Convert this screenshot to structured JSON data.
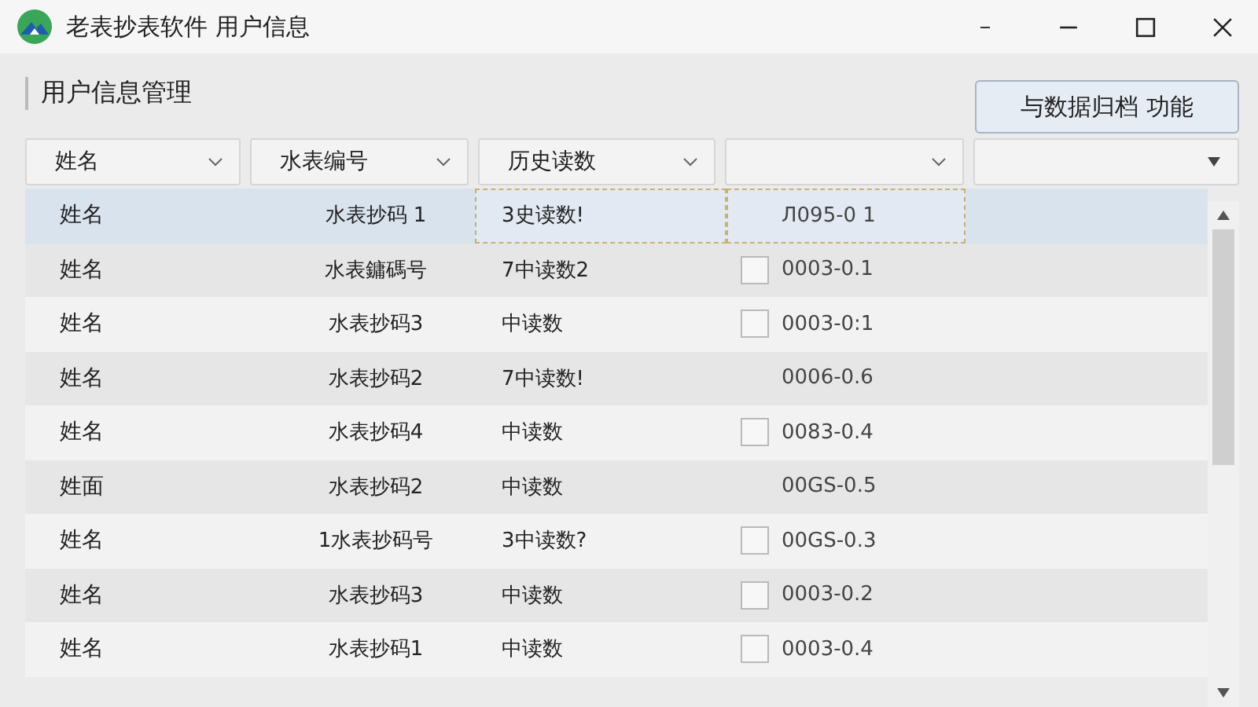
{
  "window": {
    "title": "老表抄表软件 用户信息"
  },
  "panel": {
    "heading": "用户信息管理",
    "action_button": "与数据归档 功能"
  },
  "table": {
    "columns": [
      {
        "label": "姓名"
      },
      {
        "label": "水表编号"
      },
      {
        "label": "历史读数"
      },
      {},
      {}
    ],
    "rows": [
      {
        "selected": true,
        "kind": "plain",
        "name": "姓名",
        "meter": "水表抄码 1",
        "history": "3史读数!",
        "code": "Л095-0 1"
      },
      {
        "selected": false,
        "kind": "checkbox",
        "checked": false,
        "name": "姓名",
        "meter": "水表鏞碼号",
        "history": "7中读数2",
        "code": "0003-0.1"
      },
      {
        "selected": false,
        "kind": "checkbox",
        "checked": false,
        "name": "姓名",
        "meter": "水表抄码3",
        "history": "中读数",
        "code": "0003-0:1"
      },
      {
        "selected": false,
        "kind": "plain",
        "name": "姓名",
        "meter": "水表抄码2",
        "history": "7中读数!",
        "code": "0006-0.6"
      },
      {
        "selected": false,
        "kind": "checkbox",
        "checked": false,
        "name": "姓名",
        "meter": "水表抄码4",
        "history": "中读数",
        "code": "0083-0.4"
      },
      {
        "selected": false,
        "kind": "plain",
        "name": "姓面",
        "meter": "水表抄码2",
        "history": "中读数",
        "code": "00GS-0.5"
      },
      {
        "selected": false,
        "kind": "checkbox",
        "checked": false,
        "name": "姓名",
        "meter": "1水表抄码号",
        "history": "3中读数?",
        "code": "00GS-0.3"
      },
      {
        "selected": false,
        "kind": "checkbox",
        "checked": false,
        "name": "姓名",
        "meter": "水表抄码3",
        "history": "中读数",
        "code": "0003-0.2"
      },
      {
        "selected": false,
        "kind": "checkbox",
        "checked": false,
        "name": "姓名",
        "meter": "水表抄码1",
        "history": "中读数",
        "code": "0003-0.4"
      }
    ]
  }
}
